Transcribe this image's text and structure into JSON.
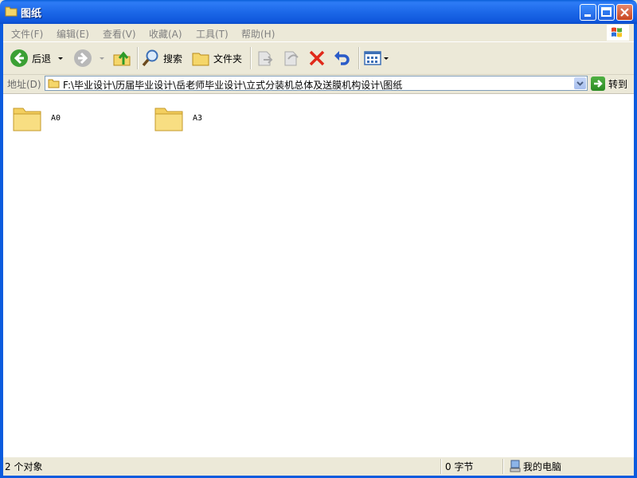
{
  "window": {
    "title": "图纸"
  },
  "menu": {
    "items": [
      {
        "label": "文件(F)"
      },
      {
        "label": "编辑(E)"
      },
      {
        "label": "查看(V)"
      },
      {
        "label": "收藏(A)"
      },
      {
        "label": "工具(T)"
      },
      {
        "label": "帮助(H)"
      }
    ]
  },
  "toolbar": {
    "back_label": "后退",
    "search_label": "搜索",
    "folders_label": "文件夹"
  },
  "address": {
    "label": "地址(D)",
    "path": "F:\\毕业设计\\历届毕业设计\\岳老师毕业设计\\立式分装机总体及送膜机构设计\\图纸",
    "go_label": "转到"
  },
  "content": {
    "items": [
      {
        "name": "A0"
      },
      {
        "name": "A3"
      }
    ]
  },
  "status": {
    "objects": "2 个对象",
    "size": "0 字节",
    "location": "我的电脑"
  },
  "colors": {
    "titlebar": "#1C68E8",
    "frame": "#0B5BDE",
    "chrome": "#ECE9D8",
    "folder": "#F5D66A"
  }
}
